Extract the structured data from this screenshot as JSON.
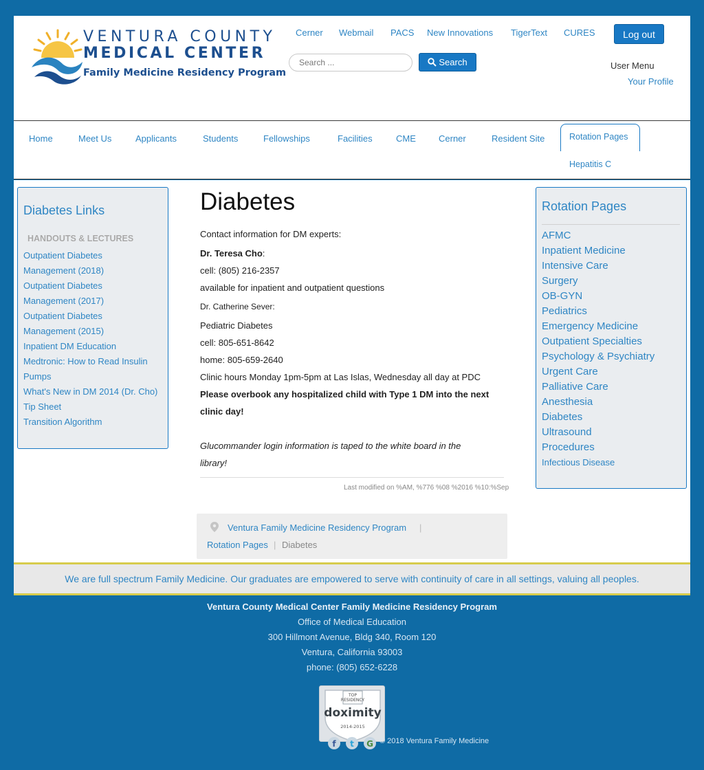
{
  "logo": {
    "line1": "VENTURA COUNTY",
    "line2": "MEDICAL CENTER",
    "line3": "Family Medicine Residency Program"
  },
  "toplinks": [
    "Cerner",
    "Webmail",
    "PACS",
    "New Innovations",
    "TigerText",
    "CURES"
  ],
  "logout_label": "Log out",
  "search": {
    "placeholder": "Search ...",
    "button_label": "Search"
  },
  "user_menu": {
    "title": "User Menu",
    "profile": "Your Profile"
  },
  "nav": {
    "items": [
      "Home",
      "Meet Us",
      "Applicants",
      "Students",
      "Fellowships",
      "Facilities",
      "CME",
      "Cerner",
      "Resident Site"
    ],
    "active": "Rotation Pages",
    "sub": "Hepatitis C"
  },
  "left_sidebar": {
    "title": "Diabetes Links",
    "heading": "HANDOUTS & LECTURES",
    "lines": [
      "Outpatient Diabetes",
      "Management (2018)",
      "Outpatient Diabetes",
      "Management (2017)",
      "Outpatient Diabetes",
      "Management (2015)",
      "Inpatient DM Education",
      "Medtronic: How to Read Insulin",
      "Pumps",
      "What's New in DM 2014 (Dr. Cho)",
      "Tip Sheet",
      "Transition Algorithm"
    ]
  },
  "article": {
    "title": "Diabetes",
    "intro": "Contact information for DM experts:",
    "expert1_name": "Dr. Teresa Cho",
    "expert1_colon": ":",
    "expert1_cell": "cell: (805) 216-2357",
    "expert1_note": "available for inpatient and outpatient questions",
    "expert2_name": "Dr. Catherine Sever:",
    "expert2_role": "Pediatric Diabetes",
    "expert2_cell": "cell: 805-651-8642",
    "expert2_home": "home: 805-659-2640",
    "clinic_hours": "Clinic hours Monday 1pm-5pm at Las Islas, Wednesday all day at PDC",
    "warning_line1": "Please overbook any hospitalized child with Type 1 DM into the next",
    "warning_line2": "clinic day!",
    "note_line1": "Glucommander login information is taped to the white board in the",
    "note_line2": "library!",
    "last_modified": "Last modified on %AM, %776 %08 %2016 %10:%Sep"
  },
  "breadcrumb": {
    "items": [
      "Ventura Family Medicine Residency Program",
      "Rotation Pages",
      "Diabetes"
    ],
    "separator": "|"
  },
  "right_sidebar": {
    "title": "Rotation Pages",
    "items": [
      "AFMC",
      "Inpatient Medicine",
      "Intensive Care",
      "Surgery",
      "OB-GYN",
      "Pediatrics",
      "Emergency Medicine",
      "Outpatient Specialties",
      "Psychology & Psychiatry",
      "Urgent Care",
      "Palliative Care",
      "Anesthesia",
      "Diabetes",
      "Ultrasound",
      "Procedures"
    ],
    "small_item": "Infectious Disease"
  },
  "tagline": "We are full spectrum Family Medicine. Our graduates are empowered to serve with continuity of care in all settings, valuing all peoples.",
  "footer": {
    "name": "Ventura County Medical Center Family Medicine Residency Program",
    "office": "Office of Medical Education",
    "address": "300 Hillmont Avenue, Bldg 340, Room 120",
    "city": "Ventura, California 93003",
    "phone": "phone: (805) 652-6228",
    "badge_top": "TOP",
    "badge_residency": "RESIDENCY",
    "badge_brand": "doximity",
    "badge_years": "2014-2015",
    "copyright": "© 2018 Ventura Family Medicine",
    "social_icons": [
      "facebook-icon",
      "twitter-icon",
      "google-icon"
    ]
  },
  "colors": {
    "background": "#0f6ba5",
    "link": "#2f86c4",
    "button": "#1878c4",
    "logo_navy": "#1d4f8f",
    "tagline_border": "#d7cc4c"
  }
}
